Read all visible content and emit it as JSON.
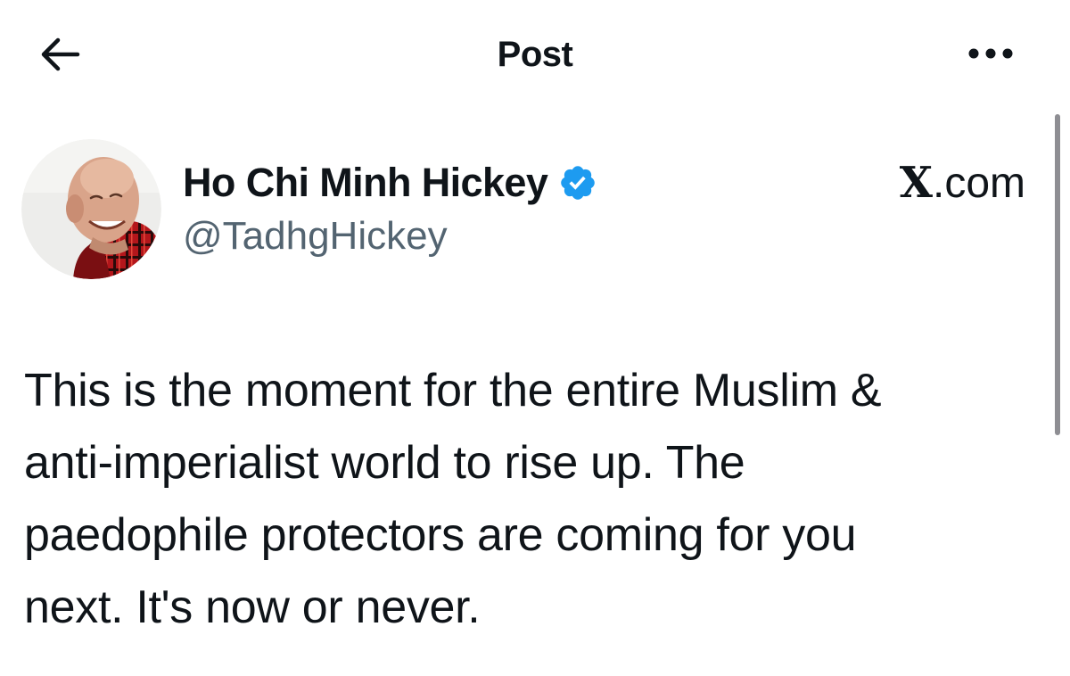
{
  "header": {
    "back_icon": "arrow-left-icon",
    "title": "Post",
    "more_icon": "more-horizontal-icon"
  },
  "post": {
    "author": {
      "display_name": "Ho Chi Minh Hickey",
      "handle": "@TadhgHickey",
      "verified": true,
      "verified_icon": "verified-badge-icon",
      "avatar": "author-avatar"
    },
    "watermark": {
      "glyph": "X",
      "suffix": ".com"
    },
    "text": "This is the moment for the entire Muslim &\nanti-imperialist world to rise up. The\npaedophile protectors are coming for you\nnext. It's now or never."
  },
  "colors": {
    "text": "#0f1419",
    "secondary_text": "#536471",
    "verified_blue": "#1d9bf0",
    "background": "#ffffff"
  }
}
